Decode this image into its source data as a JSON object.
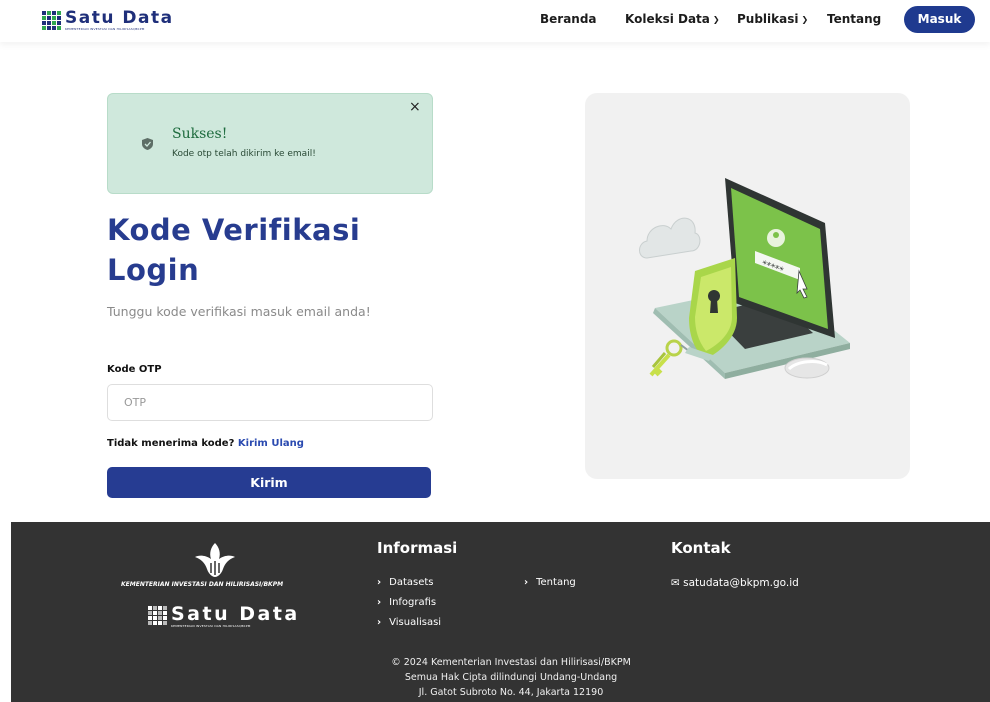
{
  "brand": {
    "name": "Satu Data",
    "subtitle": "KEMENTERIAN INVESTASI DAN HILIRISASI/BKPM",
    "grid_colors": [
      "#1f2f7a",
      "#2fa84f",
      "#1f2f7a",
      "#2fa84f",
      "#2fa84f",
      "#1f2f7a",
      "#2fa84f",
      "#1f2f7a",
      "#1f2f7a",
      "#1f2f7a",
      "#2fa84f",
      "#1f2f7a",
      "#2fa84f",
      "#1f2f7a",
      "#1f2f7a",
      "#2fa84f"
    ]
  },
  "nav": {
    "home": "Beranda",
    "collections": "Koleksi Data",
    "publications": "Publikasi",
    "about": "Tentang",
    "login": "Masuk"
  },
  "alert": {
    "title": "Sukses!",
    "message": "Kode otp telah dikirim ke email!",
    "close": "×"
  },
  "main": {
    "title": "Kode Verifikasi Login",
    "subtitle": "Tunggu kode verifikasi masuk email anda!",
    "otp_label": "Kode OTP",
    "otp_placeholder": "OTP",
    "otp_value": "",
    "resend_prefix": "Tidak menerima kode?",
    "resend_link": "Kirim Ulang",
    "submit": "Kirim"
  },
  "footer": {
    "ministry": "KEMENTERIAN INVESTASI DAN HILIRISASI/BKPM",
    "info_heading": "Informasi",
    "links_col1": [
      "Datasets",
      "Infografis",
      "Visualisasi"
    ],
    "links_col2": [
      "Tentang"
    ],
    "contact_heading": "Kontak",
    "email": "satudata@bkpm.go.id",
    "copyright_line1": "2024 Kementerian Investasi dan Hilirisasi/BKPM",
    "copyright_line2": "Semua Hak Cipta dilindungi Undang-Undang",
    "copyright_line3": "Jl. Gatot Subroto No. 44, Jakarta 12190"
  },
  "colors": {
    "primary": "#263c92",
    "success_bg": "#cfe8dc",
    "success_text": "#1e6b3e",
    "footer_bg": "#333333"
  }
}
